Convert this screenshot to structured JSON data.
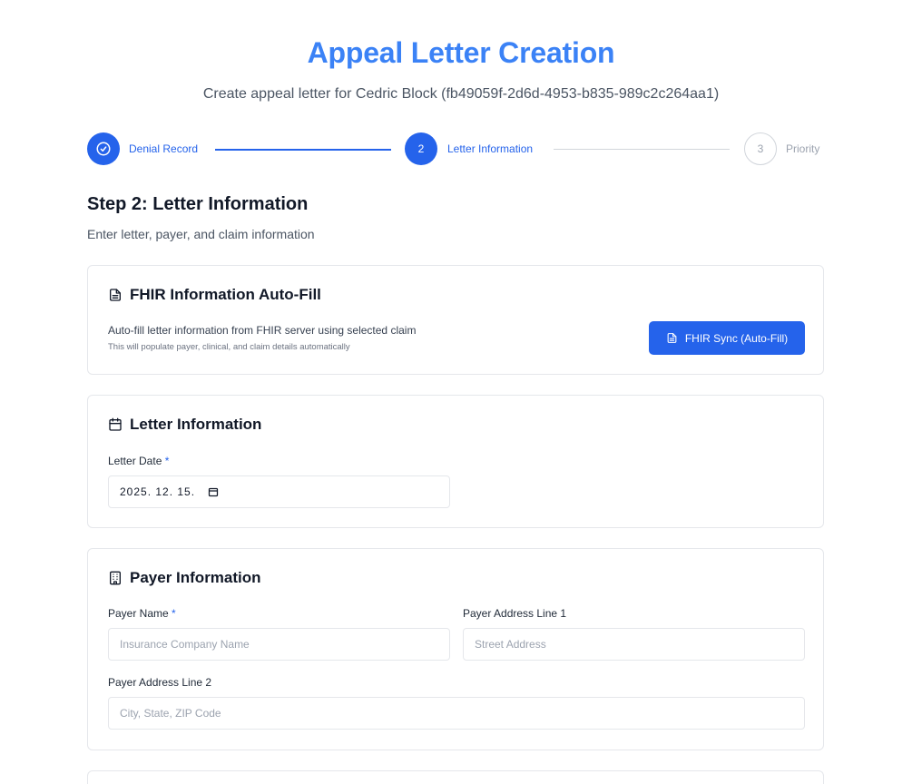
{
  "header": {
    "title": "Appeal Letter Creation",
    "subtitle": "Create appeal letter for Cedric Block (fb49059f-2d6d-4953-b835-989c2c264aa1)"
  },
  "stepper": {
    "steps": [
      {
        "number": "1",
        "label": "Denial Record",
        "state": "completed"
      },
      {
        "number": "2",
        "label": "Letter Information",
        "state": "active"
      },
      {
        "number": "3",
        "label": "Priority",
        "state": "pending"
      }
    ]
  },
  "step": {
    "title": "Step 2: Letter Information",
    "description": "Enter letter, payer, and claim information"
  },
  "fhir": {
    "title": "FHIR Information Auto-Fill",
    "description": "Auto-fill letter information from FHIR server using selected claim",
    "note": "This will populate payer, clinical, and claim details automatically",
    "button_label": "FHIR Sync (Auto-Fill)"
  },
  "letter": {
    "title": "Letter Information",
    "date_label": "Letter Date",
    "required_mark": "*",
    "date_value": "2025. 12. 15."
  },
  "payer": {
    "title": "Payer Information",
    "name_label": "Payer Name",
    "required_mark": "*",
    "name_placeholder": "Insurance Company Name",
    "address1_label": "Payer Address Line 1",
    "address1_placeholder": "Street Address",
    "address2_label": "Payer Address Line 2",
    "address2_placeholder": "City, State, ZIP Code"
  },
  "colors": {
    "accent": "#2563eb",
    "title": "#3b82f6",
    "border": "#e5e7eb"
  },
  "icons": [
    "check-circle-icon",
    "document-icon",
    "calendar-icon",
    "building-icon"
  ]
}
